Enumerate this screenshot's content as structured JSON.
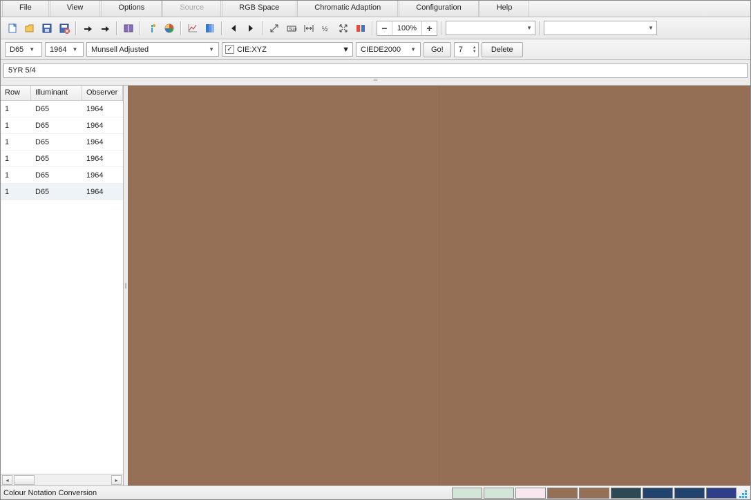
{
  "menu": {
    "file": "File",
    "view": "View",
    "options": "Options",
    "source": "Source",
    "rgb": "RGB Space",
    "chroma": "Chromatic Adaption",
    "config": "Configuration",
    "help": "Help"
  },
  "toolbar": {
    "zoom": "100%"
  },
  "opt": {
    "illum": "D65",
    "observer": "1964",
    "notation": "Munsell Adjusted",
    "space": "CIE:XYZ",
    "delta": "CIEDE2000",
    "go": "Go!",
    "spin": "7",
    "delete": "Delete"
  },
  "label": "5YR 5/4",
  "table": {
    "head": {
      "row": "Row",
      "illum": "Illuminant",
      "obs": "Observer"
    },
    "rows": [
      {
        "r": "1",
        "i": "D65",
        "o": "1964"
      },
      {
        "r": "1",
        "i": "D65",
        "o": "1964"
      },
      {
        "r": "1",
        "i": "D65",
        "o": "1964"
      },
      {
        "r": "1",
        "i": "D65",
        "o": "1964"
      },
      {
        "r": "1",
        "i": "D65",
        "o": "1964"
      },
      {
        "r": "1",
        "i": "D65",
        "o": "1964"
      }
    ],
    "selected_index": 5
  },
  "status": "Colour Notation Conversion",
  "swatches": [
    "#d3e5d8",
    "#d3e5d8",
    "#f8e7ee",
    "#966f57",
    "#966f57",
    "#2c4a56",
    "#23436f",
    "#23436f",
    "#2e3e8a"
  ],
  "preview": {
    "left": "#966f57",
    "right": "#956e56"
  }
}
